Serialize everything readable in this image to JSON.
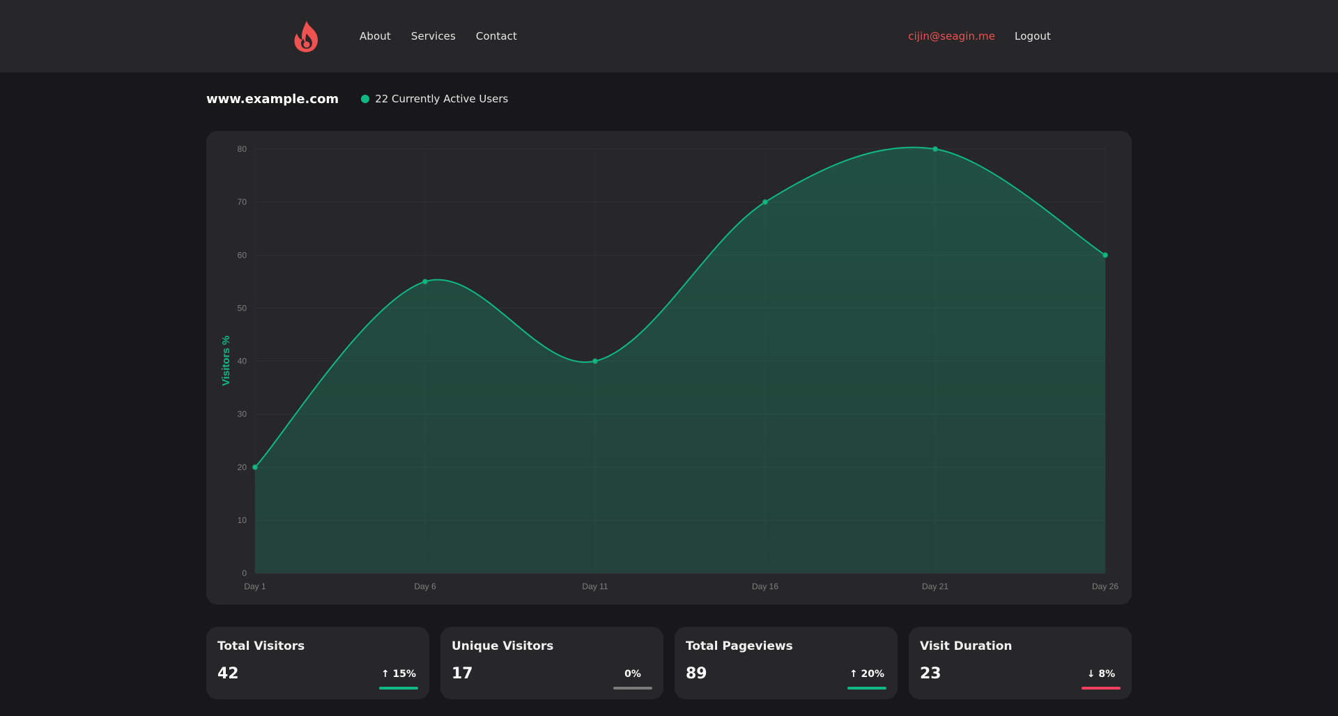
{
  "header": {
    "nav": [
      "About",
      "Services",
      "Contact"
    ],
    "user_email": "cijin@seagin.me",
    "logout_label": "Logout",
    "logo_icon": "flame-icon",
    "accent_color": "#f05252"
  },
  "site": {
    "domain": "www.example.com",
    "active_users": "22 Currently Active Users",
    "live_color": "#10b981"
  },
  "chart_data": {
    "type": "area",
    "x": [
      "Day 1",
      "Day 6",
      "Day 11",
      "Day 16",
      "Day 21",
      "Day 26"
    ],
    "series": [
      {
        "values": [
          20,
          55,
          40,
          70,
          80,
          60
        ],
        "color": "#10b981"
      }
    ],
    "ylabel": "Visitors %",
    "ylim": [
      0,
      80
    ],
    "yticks": [
      0,
      10,
      20,
      30,
      40,
      50,
      60,
      70,
      80
    ],
    "grid": true
  },
  "stats": [
    {
      "title": "Total Visitors",
      "value": "42",
      "change": "15%",
      "direction": "up",
      "color": "#10b981"
    },
    {
      "title": "Unique Visitors",
      "value": "17",
      "change": "0%",
      "direction": "flat",
      "color": "#7a7a7a"
    },
    {
      "title": "Total Pageviews",
      "value": "89",
      "change": "20%",
      "direction": "up",
      "color": "#10b981"
    },
    {
      "title": "Visit Duration",
      "value": "23",
      "change": "8%",
      "direction": "down",
      "color": "#f43f5e"
    }
  ]
}
